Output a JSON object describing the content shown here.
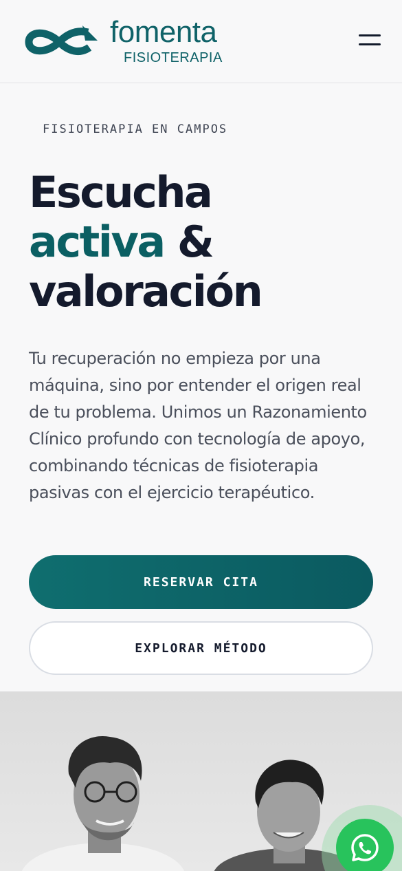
{
  "header": {
    "brand_name": "fomenta",
    "brand_sub": "FISIOTERAPIA",
    "logo_icon": "infinity-logo-icon",
    "menu_icon": "hamburger-menu-icon",
    "brand_color": "#0f6268"
  },
  "hero": {
    "eyebrow": "FISIOTERAPIA EN CAMPOS",
    "title_line1": "Escucha",
    "title_accent": "activa",
    "title_amp": "&",
    "title_line3": "valoración",
    "description": "Tu recuperación no empieza por una máquina, sino por entender el origen real de tu problema. Unimos un Razonamiento Clínico profundo con tecnología de apoyo, combinando técnicas de fisioterapia pasivas con el ejercicio terapéutico.",
    "accent_color": "#0b5f63"
  },
  "actions": {
    "primary_label": "RESERVAR CITA",
    "secondary_label": "EXPLORAR MÉTODO"
  },
  "photo": {
    "subject": "team-photo"
  },
  "whatsapp": {
    "icon": "whatsapp-icon",
    "color": "#28c35c"
  }
}
